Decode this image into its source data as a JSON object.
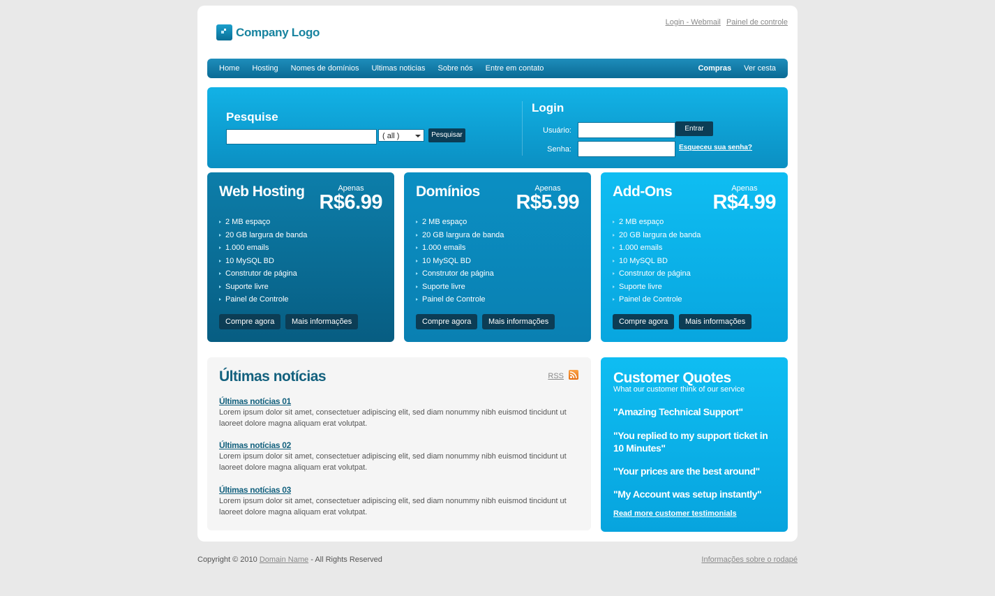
{
  "header": {
    "logo_text": "Company Logo",
    "links": [
      "Login - Webmail",
      "Painel de controle"
    ]
  },
  "nav": {
    "left": [
      "Home",
      "Hosting",
      "Nomes de domínios",
      "Ultimas noticias",
      "Sobre nós",
      "Entre em contato"
    ],
    "right": [
      "Compras",
      "Ver cesta"
    ]
  },
  "search": {
    "title": "Pesquise",
    "input_value": "",
    "select_value": "( all )",
    "button": "Pesquisar"
  },
  "login": {
    "title": "Login",
    "user_label": "Usuário:",
    "pass_label": "Senha:",
    "button": "Entrar",
    "forgot": "Esqueceu sua senha?"
  },
  "plans": [
    {
      "title": "Web Hosting",
      "apenas": "Apenas",
      "price": "R$6.99",
      "color": "#0a6d93",
      "features": [
        "2 MB espaço",
        "20 GB largura de banda",
        "1.000 emails",
        "10 MySQL BD",
        "Construtor de página",
        "Suporte livre",
        "Painel de Controle"
      ],
      "buy": "Compre agora",
      "more": "Mais informações"
    },
    {
      "title": "Domínios",
      "apenas": "Apenas",
      "price": "R$5.99",
      "color": "#0a8cbf",
      "features": [
        "2 MB espaço",
        "20 GB largura de banda",
        "1.000 emails",
        "10 MySQL BD",
        "Construtor de página",
        "Suporte livre",
        "Painel de Controle"
      ],
      "buy": "Compre agora",
      "more": "Mais informações"
    },
    {
      "title": "Add-Ons",
      "apenas": "Apenas",
      "price": "R$4.99",
      "color": "#08b6ee",
      "features": [
        "2 MB espaço",
        "20 GB largura de banda",
        "1.000 emails",
        "10 MySQL BD",
        "Construtor de página",
        "Suporte livre",
        "Painel de Controle"
      ],
      "buy": "Compre agora",
      "more": "Mais informações"
    }
  ],
  "news": {
    "title": "Últimas notícias",
    "rss": "RSS",
    "items": [
      {
        "title": "Últimas notícias 01",
        "text": "Lorem ipsum dolor sit amet, consectetuer adipiscing elit, sed diam nonummy nibh euismod tincidunt ut laoreet dolore magna aliquam erat volutpat."
      },
      {
        "title": "Últimas notícias 02",
        "text": "Lorem ipsum dolor sit amet, consectetuer adipiscing elit, sed diam nonummy nibh euismod tincidunt ut laoreet dolore magna aliquam erat volutpat."
      },
      {
        "title": "Últimas notícias 03",
        "text": "Lorem ipsum dolor sit amet, consectetuer adipiscing elit, sed diam nonummy nibh euismod tincidunt ut laoreet dolore magna aliquam erat volutpat."
      }
    ]
  },
  "quotes": {
    "title": "Customer Quotes",
    "subtitle": "What our customer think of our service",
    "items": [
      "\"Amazing Technical Support\"",
      "\"You replied to my support ticket in 10 Minutes\"",
      "\"Your prices are the best around\"",
      "\"My Account was setup instantly\""
    ],
    "more": "Read more customer testimonials"
  },
  "footer": {
    "copyright": "Copyright © 2010",
    "domain": "Domain Name",
    "rights": "- All Rights Reserved",
    "right_link": "Informações sobre o rodapé"
  }
}
